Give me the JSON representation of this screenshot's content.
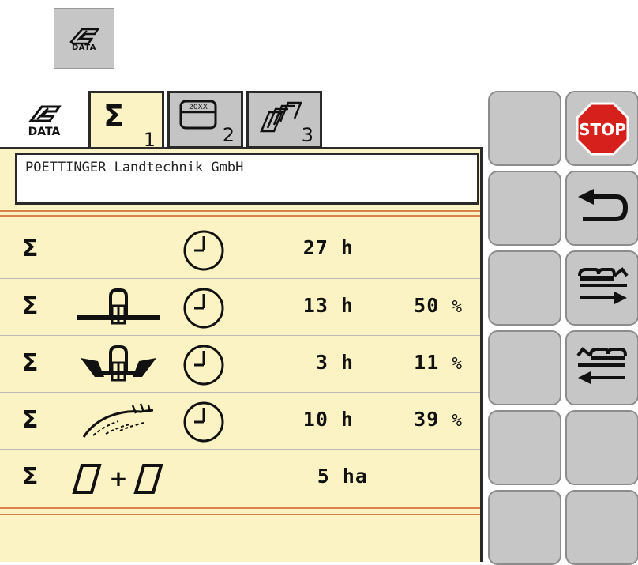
{
  "toolbar": {
    "data_icon_label": "DATA"
  },
  "tabs": [
    {
      "label": "DATA"
    },
    {
      "label": "Σ",
      "number": "1"
    },
    {
      "label": "20XX",
      "number": "2"
    },
    {
      "label": "",
      "number": "3"
    }
  ],
  "company": "POETTINGER Landtechnik GmbH",
  "rows": [
    {
      "sigma": "Σ",
      "hours": "27 h",
      "percent": "",
      "percent_sign": ""
    },
    {
      "sigma": "Σ",
      "hours": "13 h",
      "percent": "50",
      "percent_sign": "%"
    },
    {
      "sigma": "Σ",
      "hours": "3 h",
      "percent": "11",
      "percent_sign": "%"
    },
    {
      "sigma": "Σ",
      "hours": "10 h",
      "percent": "39",
      "percent_sign": "%"
    },
    {
      "sigma": "Σ",
      "area_symbol": "+",
      "hours": "5 ha"
    }
  ],
  "buttons": {
    "stop": "STOP"
  },
  "colors": {
    "panel_bg": "#fcf3c5",
    "button_bg": "#c6c6c6",
    "stop_red": "#d6201c",
    "divider_orange": "#d9834a"
  },
  "icons": {
    "data": "data-logo-icon",
    "clock": "clock-icon",
    "back": "back-arrow-icon",
    "move_right": "move-right-icon",
    "move_left": "move-left-icon"
  }
}
